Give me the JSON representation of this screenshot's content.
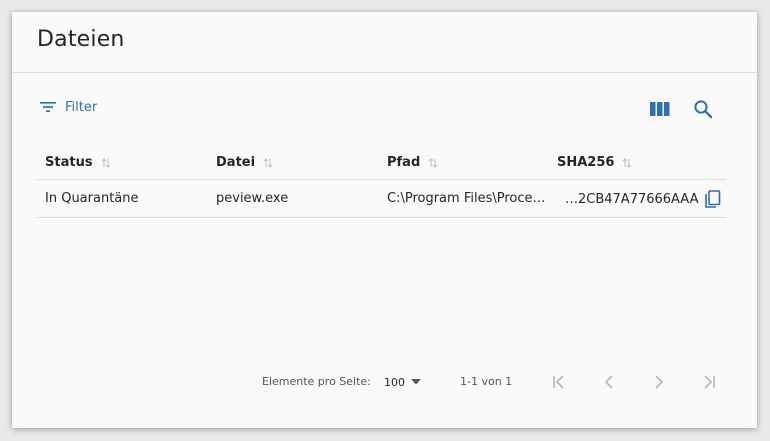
{
  "card": {
    "title": "Dateien"
  },
  "toolbar": {
    "filter_label": "Filter",
    "columns_icon": "view-columns-icon",
    "search_icon": "search-icon"
  },
  "table": {
    "columns": [
      "Status",
      "Datei",
      "Pfad",
      "SHA256"
    ],
    "rows": [
      {
        "status": "In Quarantäne",
        "datei": "peview.exe",
        "pfad": "C:\\Program Files\\Process Explorer\\peview.exe",
        "sha256": "…2CB47A77666AAA"
      }
    ]
  },
  "paginator": {
    "items_per_page_label": "Elemente pro Seite:",
    "page_size": "100",
    "range_label": "1-1 von 1"
  },
  "colors": {
    "accent": "#2a6fb8",
    "text": "#262626",
    "muted": "#c4c4c4",
    "divider": "#dcdcdc",
    "surface": "#fafafa"
  }
}
